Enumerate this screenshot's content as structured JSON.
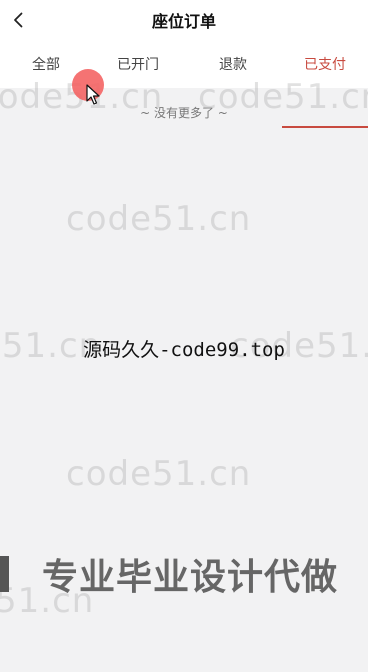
{
  "header": {
    "title": "座位订单"
  },
  "tabs": [
    {
      "label": "全部"
    },
    {
      "label": "已开门"
    },
    {
      "label": "退款"
    },
    {
      "label": "已支付"
    }
  ],
  "active_tab_index": 3,
  "status": {
    "no_more": "~ 没有更多了 ~"
  },
  "watermarks": [
    "code51.cn",
    "code51.cn",
    "code51.cn",
    "e51.cn",
    "code51.cn",
    "code51.cn",
    "51.cn"
  ],
  "center_text": "源码久久-code99.top",
  "banner": {
    "text": "专业毕业设计代做"
  },
  "colors": {
    "accent": "#c84a3f",
    "background": "#f2f2f3",
    "header_bg": "#ffffff",
    "touch_dot": "#f46060"
  },
  "icons": {
    "back": "chevron-left-icon",
    "cursor": "mouse-pointer-icon"
  }
}
